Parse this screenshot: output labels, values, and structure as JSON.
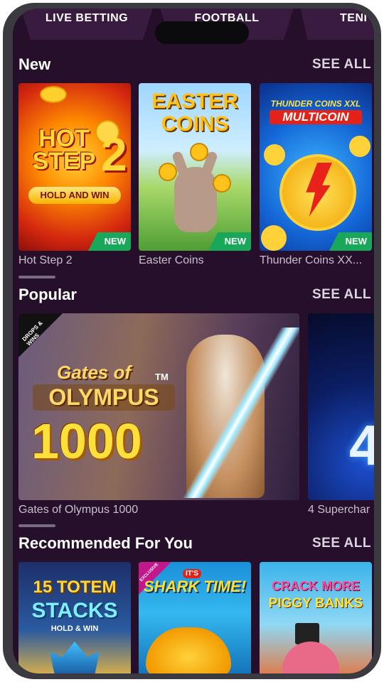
{
  "tabs": [
    "LIVE BETTING",
    "FOOTBALL",
    "TENI"
  ],
  "sections": {
    "new": {
      "title": "New",
      "see_all": "SEE ALL",
      "games": [
        {
          "name": "Hot Step 2",
          "art_line1": "HOT",
          "art_line2": "STEP",
          "art_num": "2",
          "art_sub": "HOLD AND WIN",
          "badge": "NEW"
        },
        {
          "name": "Easter Coins",
          "art_line1": "EASTER",
          "art_line2": "COINS",
          "badge": "NEW"
        },
        {
          "name": "Thunder Coins XX...",
          "art_line1": "THUNDER COINS XXL",
          "art_line2": "MULTICOIN",
          "badge": "NEW"
        }
      ]
    },
    "popular": {
      "title": "Popular",
      "see_all": "SEE ALL",
      "games": [
        {
          "name": "Gates of Olympus 1000",
          "art_line1": "Gates of",
          "art_line2": "OLYMPUS",
          "art_num": "1000",
          "art_tm": "TM",
          "ribbon": "DROPS & WINS"
        },
        {
          "name": "4 Superchar",
          "art_num": "4"
        }
      ]
    },
    "recommended": {
      "title": "Recommended For You",
      "see_all": "SEE ALL",
      "games": [
        {
          "name": "15 Totem Stacks",
          "art_line1": "15 TOTEM",
          "art_line2": "STACKS",
          "art_sub": "HOLD & WIN"
        },
        {
          "name": "It's Shark Time!",
          "art_line1": "IT'S",
          "art_line2": "SHARK TIME!",
          "ribbon": "EXCLUSIVE"
        },
        {
          "name": "Crack More Piggy Banks",
          "art_line1": "CRACK MORE",
          "art_line2": "PIGGY BANKS"
        }
      ]
    }
  },
  "colors": {
    "background": "#260f2b",
    "badge": "#19a85a",
    "tab": "#3a1b40"
  }
}
